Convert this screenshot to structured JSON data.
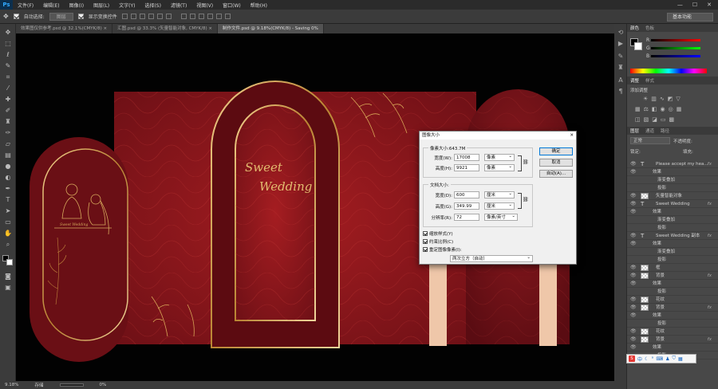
{
  "app": {
    "logo": "Ps"
  },
  "menu": [
    "文件(F)",
    "编辑(E)",
    "图像(I)",
    "图层(L)",
    "文字(Y)",
    "选择(S)",
    "滤镜(T)",
    "视图(V)",
    "窗口(W)",
    "帮助(H)"
  ],
  "options": {
    "auto_select": "自动选择:",
    "auto_select_target": "图层",
    "show_transform": "显示变换控件",
    "workspace": "基本功能"
  },
  "tabs": [
    {
      "label": "效果图仅供参考.psd @ 32.1%(CMYK/8) ×"
    },
    {
      "label": "汇图.psd @ 33.3% (矢量智能对象, CMYK/8) ×"
    },
    {
      "label": "制作文件.psd @ 9.18%(CMYK/8) - Saving 0%"
    }
  ],
  "status": {
    "zoom": "9.18%",
    "label": "存储",
    "progress": "0%"
  },
  "artwork": {
    "title_line1": "Sweet",
    "title_line2": "Wedding",
    "small_text": "Sweet Wedding"
  },
  "dialog": {
    "title": "图像大小",
    "pixel_size": "像素大小:643.7M",
    "width_label": "宽度(W):",
    "width_value": "17008",
    "width_unit": "像素",
    "height_label": "高度(H):",
    "height_value": "9921",
    "height_unit": "像素",
    "doc_size": "文档大小:",
    "doc_width_label": "宽度(D):",
    "doc_width_value": "600",
    "doc_width_unit": "厘米",
    "doc_height_label": "高度(G):",
    "doc_height_value": "349.99",
    "doc_height_unit": "厘米",
    "res_label": "分辨率(R):",
    "res_value": "72",
    "res_unit": "像素/英寸",
    "scale_styles": "缩放样式(Y)",
    "constrain": "约束比例(C)",
    "resample": "重定图像像素(I):",
    "resample_method": "两次立方（自动）",
    "ok": "确定",
    "cancel": "取消",
    "auto": "自动(A)..."
  },
  "panels": {
    "color_tabs": [
      "颜色",
      "色板"
    ],
    "r": "R",
    "g": "G",
    "b": "B",
    "adjust_tabs": [
      "调整",
      "样式"
    ],
    "adjust_title": "添加调整",
    "layers_tabs": [
      "图层",
      "通道",
      "路径"
    ],
    "blend_mode": "正常",
    "opacity": "不透明度:",
    "lock": "锁定:",
    "fill": "填充:"
  },
  "layers": [
    {
      "name": "Please accept my hea...",
      "type": "text",
      "fx": "fx"
    },
    {
      "name": "效果",
      "type": "effects"
    },
    {
      "name": "渐变叠加",
      "type": "effect"
    },
    {
      "name": "投影",
      "type": "effect"
    },
    {
      "name": "矢量智能对象",
      "type": "smart"
    },
    {
      "name": "Sweet  Wedding",
      "type": "text",
      "fx": "fx"
    },
    {
      "name": "效果",
      "type": "effects"
    },
    {
      "name": "渐变叠加",
      "type": "effect"
    },
    {
      "name": "投影",
      "type": "effect"
    },
    {
      "name": "Sweet  Wedding 副本",
      "type": "text",
      "fx": "fx"
    },
    {
      "name": "效果",
      "type": "effects"
    },
    {
      "name": "渐变叠加",
      "type": "effect"
    },
    {
      "name": "投影",
      "type": "effect"
    },
    {
      "name": "框",
      "type": "pixel"
    },
    {
      "name": "背景",
      "type": "pixel",
      "fx": "fx"
    },
    {
      "name": "效果",
      "type": "effects"
    },
    {
      "name": "投影",
      "type": "effect"
    },
    {
      "name": "花纹",
      "type": "pixel"
    },
    {
      "name": "背景",
      "type": "pixel",
      "fx": "fx"
    },
    {
      "name": "效果",
      "type": "effects"
    },
    {
      "name": "投影",
      "type": "effect"
    },
    {
      "name": "花纹",
      "type": "pixel"
    },
    {
      "name": "背景",
      "type": "pixel",
      "fx": "fx"
    },
    {
      "name": "效果",
      "type": "effects"
    },
    {
      "name": "投影",
      "type": "effect"
    }
  ],
  "ime": {
    "lang": "中"
  },
  "colors": {
    "accent": "#31a8ff",
    "wine": "#6b0f17",
    "gold": "#d9aa5e"
  }
}
